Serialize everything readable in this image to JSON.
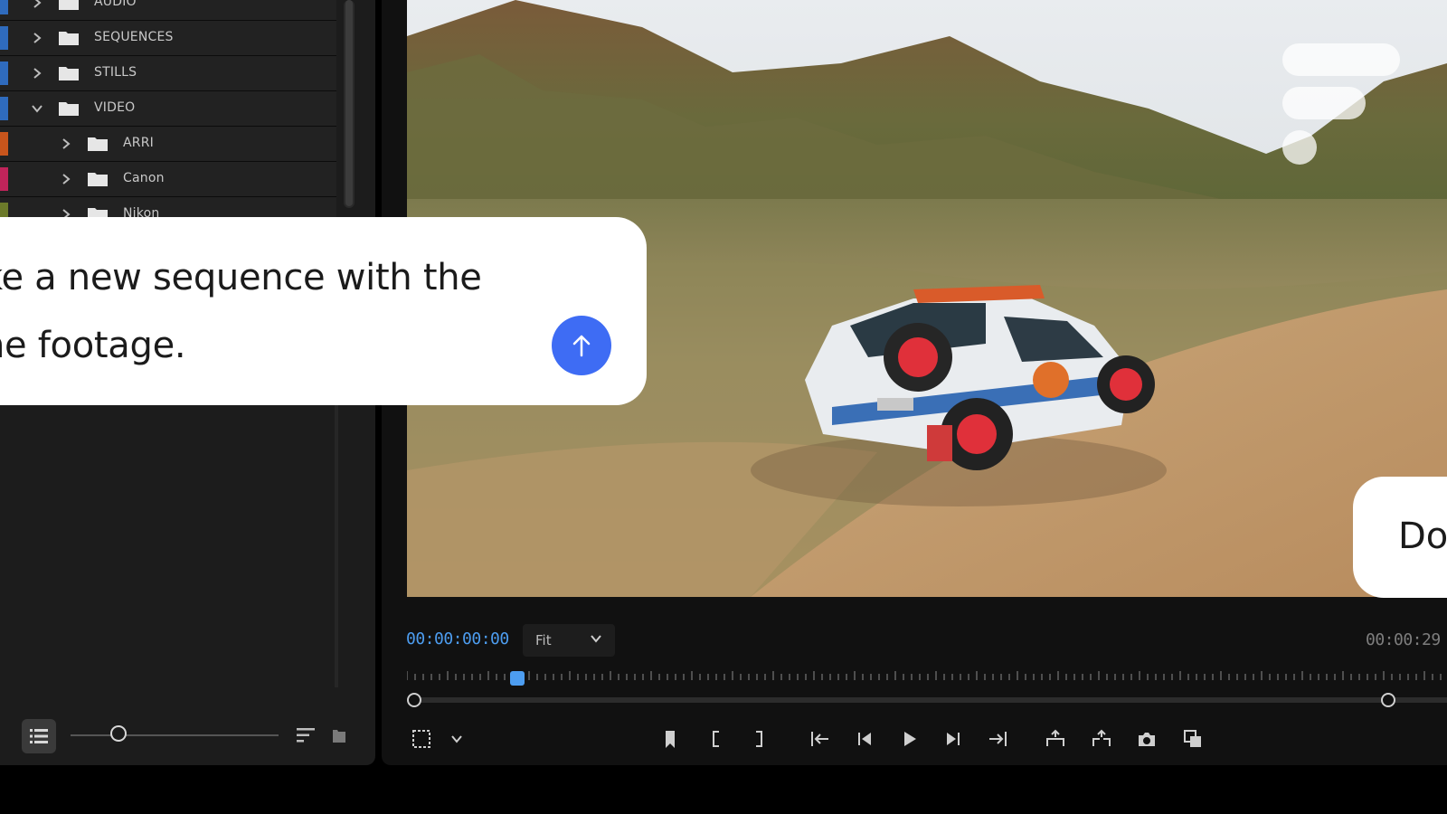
{
  "project_panel": {
    "bins": [
      {
        "label": "AUDIO",
        "expanded": false,
        "depth": 0,
        "color": "#2f6bbd"
      },
      {
        "label": "SEQUENCES",
        "expanded": false,
        "depth": 0,
        "color": "#2f6bbd"
      },
      {
        "label": "STILLS",
        "expanded": false,
        "depth": 0,
        "color": "#2f6bbd"
      },
      {
        "label": "VIDEO",
        "expanded": true,
        "depth": 0,
        "color": "#2f6bbd"
      },
      {
        "label": "ARRI",
        "expanded": false,
        "depth": 1,
        "color": "#c8551c"
      },
      {
        "label": "Canon",
        "expanded": false,
        "depth": 1,
        "color": "#c0245a"
      },
      {
        "label": "Nikon",
        "expanded": false,
        "depth": 1,
        "color": "#6c7a2a"
      }
    ],
    "icons": {
      "list_view": "list-view-icon",
      "zoom": "zoom-slider",
      "sort": "sort-icon",
      "new_bin": "new-bin-icon"
    }
  },
  "program_monitor": {
    "timecode_current": "00:00:00:00",
    "fit_select": "Fit",
    "timecode_duration": "00:00:29",
    "controls": [
      "marker-icon",
      "mark-in-icon",
      "mark-out-icon",
      "go-to-in-icon",
      "step-back-icon",
      "play-icon",
      "step-forward-icon",
      "go-to-out-icon",
      "lift-icon",
      "extract-icon",
      "export-frame-icon",
      "compare-icon"
    ],
    "playhead_fraction": 0.1
  },
  "chat": {
    "prompt_text": "ke a new sequence with the ne footage.",
    "prompt_line1": "ke a new sequence with the",
    "prompt_line2": "ne footage.",
    "send_icon": "arrow-up-icon",
    "reply_text": "Do"
  },
  "colors": {
    "accent_blue": "#4d9df0",
    "send_button": "#3e6cf4",
    "panel_bg": "#1c1c1c"
  }
}
